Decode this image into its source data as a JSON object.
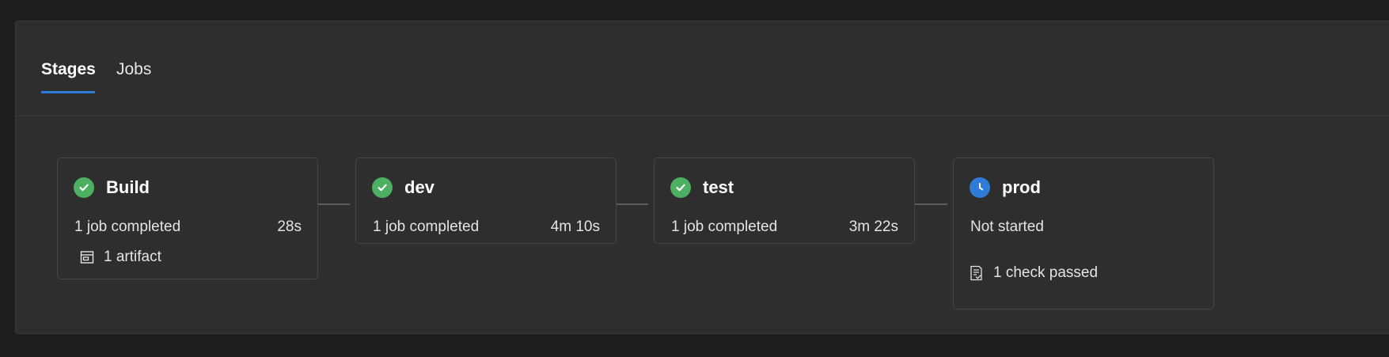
{
  "tabs": [
    {
      "label": "Stages",
      "selected": true
    },
    {
      "label": "Jobs",
      "selected": false
    }
  ],
  "stages": [
    {
      "name": "Build",
      "status_icon": "check-circle-icon",
      "status_color": "#4caf62",
      "status": "1 job completed",
      "duration": "28s",
      "extra": {
        "icon": "artifact-icon",
        "label": "1 artifact"
      }
    },
    {
      "name": "dev",
      "status_icon": "check-circle-icon",
      "status_color": "#4caf62",
      "status": "1 job completed",
      "duration": "4m 10s"
    },
    {
      "name": "test",
      "status_icon": "check-circle-icon",
      "status_color": "#4caf62",
      "status": "1 job completed",
      "duration": "3m 22s"
    },
    {
      "name": "prod",
      "status_icon": "clock-icon",
      "status_color": "#2f7bd8",
      "status": "Not started",
      "duration": "",
      "extra": {
        "icon": "checklist-icon",
        "label": "1 check passed"
      }
    }
  ],
  "colors": {
    "accent": "#2f7bd8",
    "success": "#4caf62",
    "background": "#1e1e1e",
    "panel": "#2e2e2e"
  }
}
